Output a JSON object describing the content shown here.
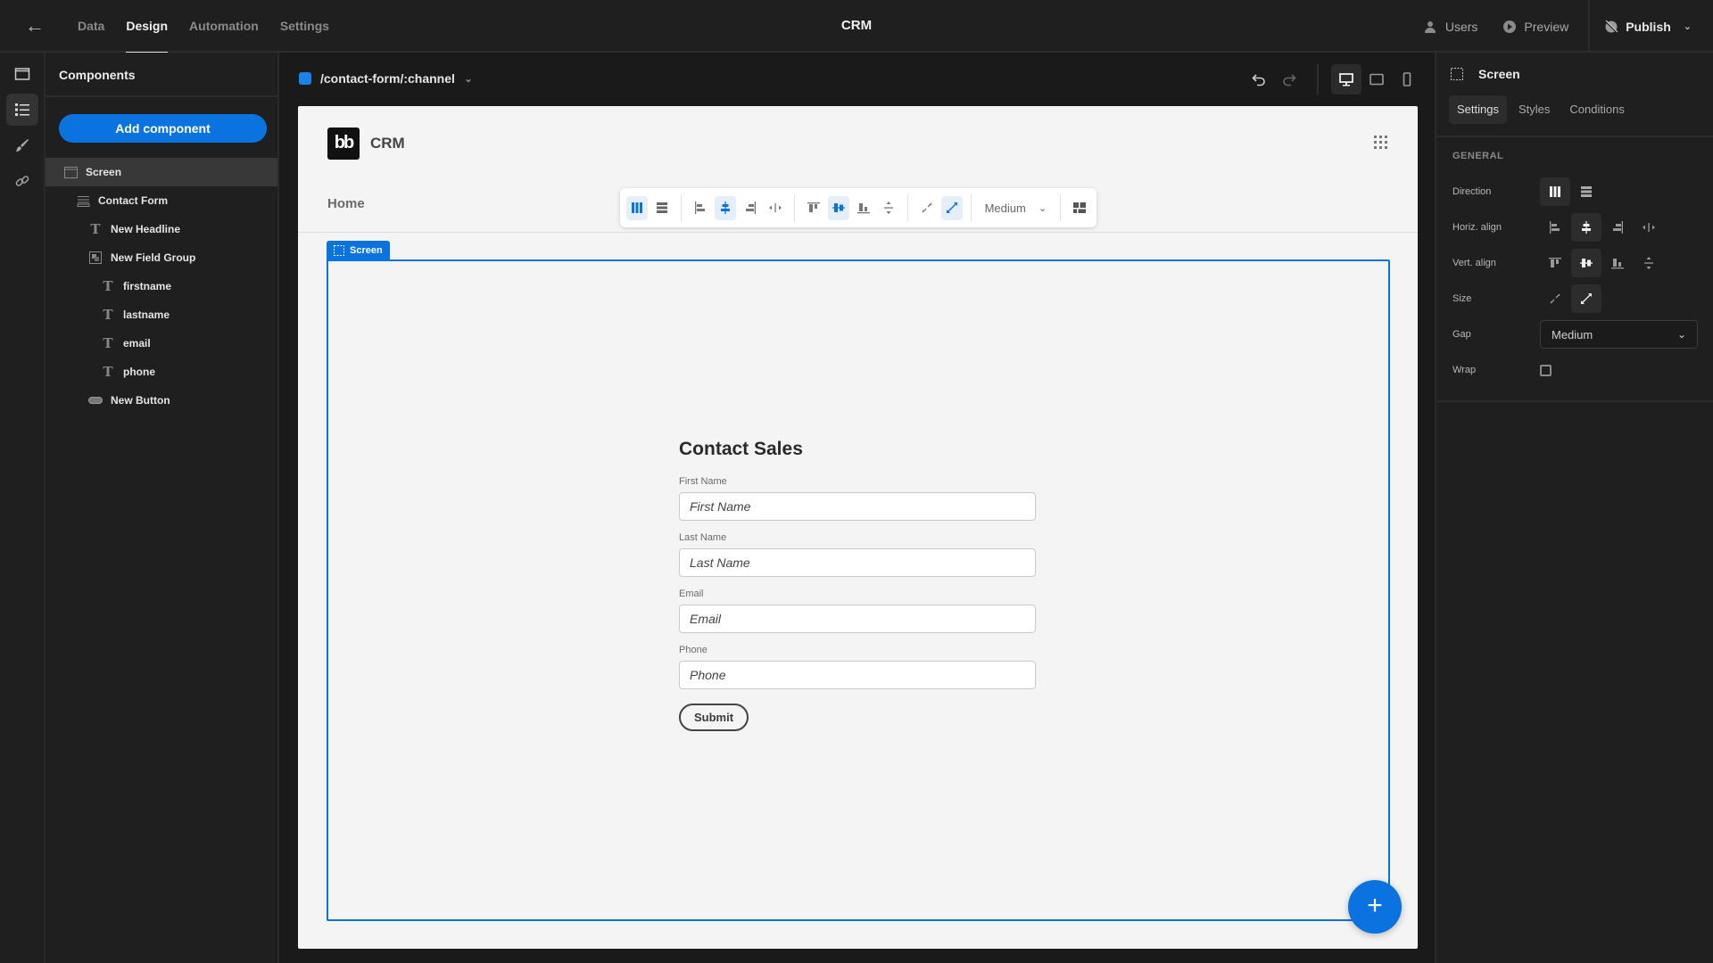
{
  "topbar": {
    "back_icon": "arrow-left-icon",
    "tabs": [
      {
        "label": "Data",
        "active": false
      },
      {
        "label": "Design",
        "active": true
      },
      {
        "label": "Automation",
        "active": false
      },
      {
        "label": "Settings",
        "active": false
      }
    ],
    "app_title": "CRM",
    "users_label": "Users",
    "preview_label": "Preview",
    "publish_label": "Publish"
  },
  "rail": {
    "items": [
      {
        "icon": "screen-icon",
        "active": false
      },
      {
        "icon": "list-icon",
        "active": true
      },
      {
        "icon": "brush-icon",
        "active": false
      },
      {
        "icon": "link-icon",
        "active": false
      }
    ]
  },
  "components": {
    "title": "Components",
    "add_label": "Add component",
    "tree": [
      {
        "label": "Screen",
        "icon": "screen-icon",
        "depth": 0,
        "selected": true
      },
      {
        "label": "Contact Form",
        "icon": "form-icon",
        "depth": 1,
        "selected": false
      },
      {
        "label": "New Headline",
        "icon": "text-icon",
        "depth": 2,
        "selected": false
      },
      {
        "label": "New Field Group",
        "icon": "field-group-icon",
        "depth": 2,
        "selected": false
      },
      {
        "label": "firstname",
        "icon": "text-field-icon",
        "depth": 3,
        "selected": false
      },
      {
        "label": "lastname",
        "icon": "text-field-icon",
        "depth": 3,
        "selected": false
      },
      {
        "label": "email",
        "icon": "text-field-icon",
        "depth": 3,
        "selected": false
      },
      {
        "label": "phone",
        "icon": "text-field-icon",
        "depth": 3,
        "selected": false
      },
      {
        "label": "New Button",
        "icon": "button-icon",
        "depth": 2,
        "selected": false
      }
    ]
  },
  "canvas": {
    "route": "/contact-form/:channel",
    "route_color": "#1a82e6",
    "device": "desktop"
  },
  "preview": {
    "logo_text": "bb",
    "app_name": "CRM",
    "nav_home": "Home",
    "toolbar": {
      "gap_value": "Medium",
      "direction": "column",
      "horiz_align": "center",
      "vert_align": "center",
      "size": "grow"
    },
    "screen_tag": "Screen",
    "form": {
      "heading": "Contact Sales",
      "fields": [
        {
          "label": "First Name",
          "placeholder": "First Name"
        },
        {
          "label": "Last Name",
          "placeholder": "Last Name"
        },
        {
          "label": "Email",
          "placeholder": "Email"
        },
        {
          "label": "Phone",
          "placeholder": "Phone"
        }
      ],
      "submit_label": "Submit"
    },
    "fab_label": "+"
  },
  "props": {
    "title": "Screen",
    "tabs": [
      {
        "label": "Settings",
        "active": true
      },
      {
        "label": "Styles",
        "active": false
      },
      {
        "label": "Conditions",
        "active": false
      }
    ],
    "section": "GENERAL",
    "direction_label": "Direction",
    "horiz_label": "Horiz. align",
    "vert_label": "Vert. align",
    "size_label": "Size",
    "gap_label": "Gap",
    "gap_value": "Medium",
    "wrap_label": "Wrap",
    "wrap_checked": false
  },
  "colors": {
    "accent": "#0a73e0",
    "panel": "#1f1f1f",
    "canvas_bg": "#f4f4f4"
  }
}
